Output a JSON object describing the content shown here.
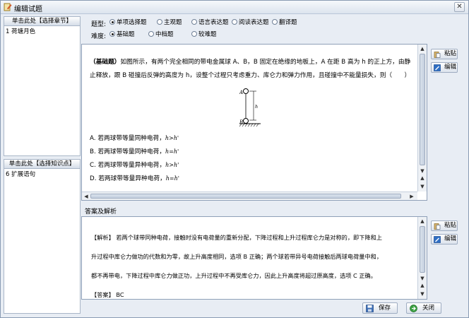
{
  "window": {
    "title": "编辑试题",
    "close_glyph": "✕"
  },
  "chapter": {
    "header": "单击此处【选择章节】",
    "items": [
      "1 荷塘月色"
    ]
  },
  "knowledge": {
    "header": "单击此处【选择知识点】",
    "items": [
      "6 扩展语句"
    ]
  },
  "question_type": {
    "label": "题型:",
    "options": [
      "单项选择题",
      "主观题",
      "语言表达题",
      "阅读表达题",
      "翻译题"
    ],
    "selected": "单项选择题"
  },
  "difficulty": {
    "label": "难度:",
    "options": [
      "基础题",
      "中档题",
      "较难题"
    ],
    "selected": "基础题"
  },
  "question": {
    "tag": "（基础题）",
    "stem": "如图所示，有两个完全相同的带电金属球 A、B，B 固定在绝缘的地板上，A 在距 B 高为 h 的正上方，由静止释放，跟 B 碰撞后反弹的高度为 h，设整个过程只考虑重力、库仑力和弹力作用，且碰撞中不能量损失，则（　　）",
    "figure_labels": {
      "a": "A",
      "b": "B",
      "h": "h"
    },
    "options": [
      {
        "text": "A. 若两球带等量同种电荷，",
        "math": "h>h'"
      },
      {
        "text": "B. 若两球带等量同种电荷，",
        "math": "h=h'"
      },
      {
        "text": "C. 若两球带等量异种电荷，",
        "math": "h>h'"
      },
      {
        "text": "D. 若两球带等量异种电荷，",
        "math": "h=h'"
      }
    ]
  },
  "side_buttons": {
    "paste": "粘贴",
    "edit": "编辑"
  },
  "answer_section": {
    "label": "答案及解析",
    "lines": [
      "【解析】 若两个球带同种电荷，接触时没有电荷量的重新分配，下降过程和上升过程库仑力是对称的，即下降和上",
      "升过程中库仑力做功的代数和为零，故上升高度相同，选项 B 正确；两个球若带异号电荷接触后两球电荷量中和，",
      "都不再带电，下降过程中库仑力做正功，上升过程中不再受库仑力，因此上升高度将超过原高度，选项 C 正确。",
      "【答案】 BC"
    ]
  },
  "footer": {
    "save": "保存",
    "close": "关闭"
  }
}
